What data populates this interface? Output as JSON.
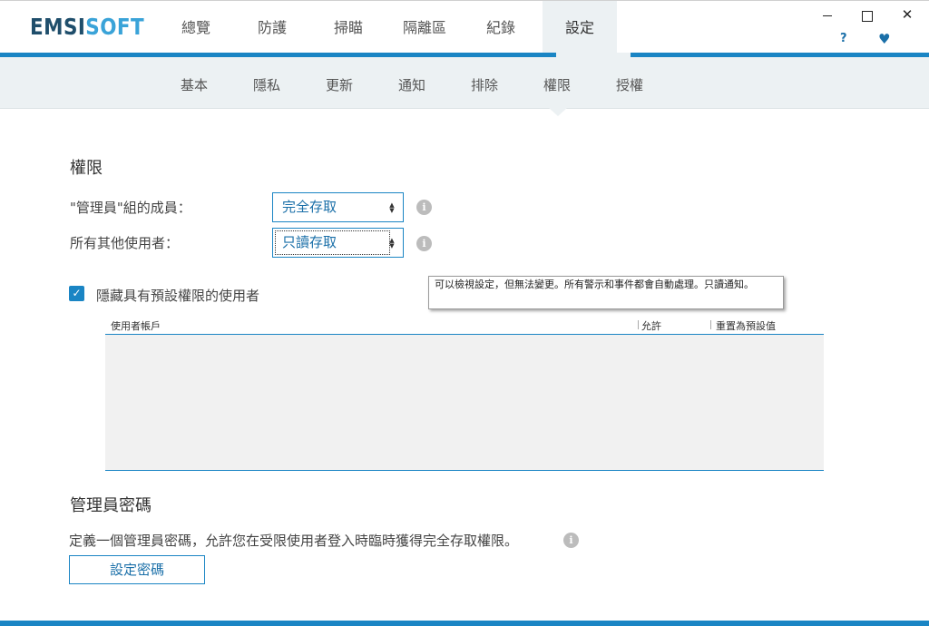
{
  "app": {
    "logo_dark": "EMSI",
    "logo_light": "SOFT"
  },
  "main_tabs": [
    "總覽",
    "防護",
    "掃瞄",
    "隔離區",
    "紀錄",
    "設定"
  ],
  "window": {
    "close_glyph": "✕",
    "help_glyph": "?",
    "heart_glyph": "♥"
  },
  "sub_tabs": [
    "基本",
    "隱私",
    "更新",
    "通知",
    "排除",
    "權限",
    "授權"
  ],
  "permissions": {
    "title": "權限",
    "admins_label": "\"管理員\"組的成員：",
    "admins_value": "完全存取",
    "others_label": "所有其他使用者：",
    "others_value": "只讀存取",
    "info_glyph": "i",
    "tooltip": "可以檢視設定，但無法變更。所有警示和事件都會自動處理。只讀通知。",
    "hide_default_checked": true,
    "check_glyph": "✓",
    "hide_default_label": "隱藏具有預設權限的使用者"
  },
  "table": {
    "columns": [
      "使用者帳戶",
      "允許",
      "重置為預設值"
    ],
    "rows": []
  },
  "admin_password": {
    "title": "管理員密碼",
    "description": "定義一個管理員密碼，允許您在受限使用者登入時臨時獲得完全存取權限。",
    "button_label": "設定密碼"
  },
  "colors": {
    "accent": "#1a85c4",
    "brand_dark": "#1f4e6b",
    "brand_light": "#3aa3d8"
  }
}
